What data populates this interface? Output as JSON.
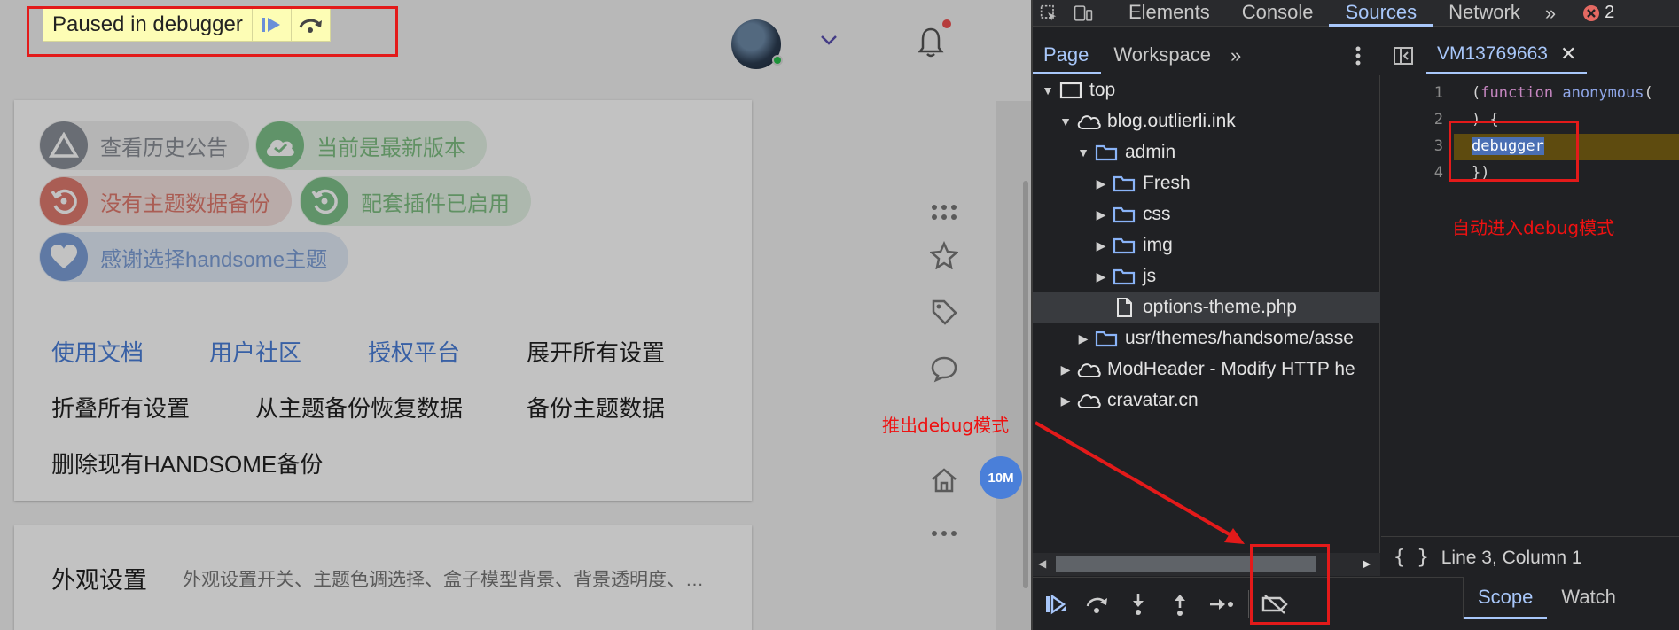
{
  "page": {
    "paused_label": "Paused in debugger",
    "tags": [
      {
        "label": "查看历史公告",
        "icon": "triangle-icon"
      },
      {
        "label": "当前是最新版本",
        "icon": "cloud-check-icon"
      },
      {
        "label": "没有主题数据备份",
        "icon": "restore-icon"
      },
      {
        "label": "配套插件已启用",
        "icon": "restore-icon"
      },
      {
        "label": "感谢选择handsome主题",
        "icon": "heart-icon"
      }
    ],
    "links": {
      "docs": "使用文档",
      "community": "用户社区",
      "license": "授权平台",
      "expand_all": "展开所有设置",
      "collapse_all": "折叠所有设置",
      "restore_backup": "从主题备份恢复数据",
      "backup": "备份主题数据",
      "delete_backup": "删除现有HANDSOME备份"
    },
    "appearance": {
      "title": "外观设置",
      "desc": "外观设置开关、主题色调选择、盒子模型背景、背景透明度、…"
    },
    "badge": "10M"
  },
  "devtools": {
    "tabs": [
      "Elements",
      "Console",
      "Sources",
      "Network"
    ],
    "active_tab": "Sources",
    "error_count": "2",
    "subtabs": [
      "Page",
      "Workspace"
    ],
    "file_tab": "VM13769663",
    "tree": [
      {
        "label": "top",
        "type": "frame",
        "open": true
      },
      {
        "label": "blog.outlierli.ink",
        "type": "cloud",
        "open": true
      },
      {
        "label": "admin",
        "type": "folder",
        "open": true
      },
      {
        "label": "Fresh",
        "type": "folder",
        "open": false
      },
      {
        "label": "css",
        "type": "folder",
        "open": false
      },
      {
        "label": "img",
        "type": "folder",
        "open": false
      },
      {
        "label": "js",
        "type": "folder",
        "open": false
      },
      {
        "label": "options-theme.php",
        "type": "file",
        "open": false
      },
      {
        "label": "usr/themes/handsome/asse",
        "type": "folder",
        "open": false
      },
      {
        "label": "ModHeader - Modify HTTP he",
        "type": "cloud",
        "open": false
      },
      {
        "label": "cravatar.cn",
        "type": "cloud",
        "open": false
      }
    ],
    "code": {
      "line_numbers": [
        "1",
        "2",
        "3",
        "4"
      ],
      "line1_kw": "function",
      "line1_fn": "anonymous",
      "line2": ") {",
      "line3": "debugger",
      "line4": "})"
    },
    "status_text": "Line 3, Column 1",
    "scope_tabs": [
      "Scope",
      "Watch"
    ]
  },
  "annotations": {
    "auto_enter": "自动进入debug模式",
    "exit": "推出debug模式"
  },
  "colors": {
    "annotation_red": "#e31a1a",
    "devtools_bg": "#202124",
    "accent_blue": "#a8c7fa",
    "link_blue": "#4a7fd9"
  }
}
